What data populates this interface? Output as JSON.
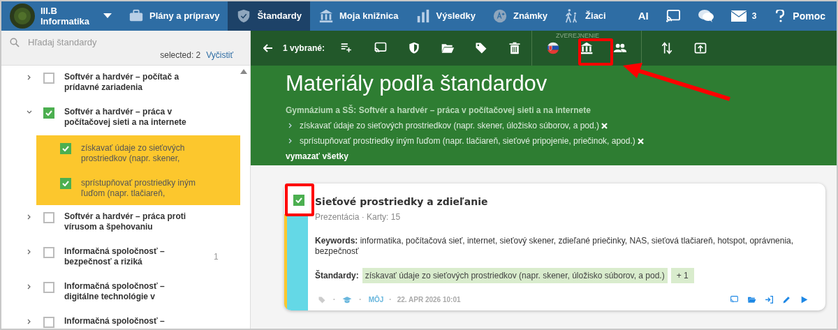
{
  "nav": {
    "brand": [
      "III.B",
      "Informatika"
    ],
    "items": [
      {
        "label": "Plány a prípravy",
        "selected": false
      },
      {
        "label": "Štandardy",
        "selected": true
      },
      {
        "label": "Moja knižnica",
        "selected": false
      },
      {
        "label": "Výsledky",
        "selected": false
      },
      {
        "label": "Známky",
        "selected": false
      },
      {
        "label": "Žiaci",
        "selected": false
      }
    ],
    "right": [
      {
        "kind": "text",
        "label": "AI"
      },
      {
        "kind": "cast"
      },
      {
        "kind": "chat"
      },
      {
        "kind": "mail",
        "badge": "3"
      },
      {
        "kind": "help",
        "label": "Pomoc"
      }
    ]
  },
  "sidebar": {
    "search_placeholder": "Hľadaj štandardy",
    "selected_count": "selected: 2",
    "clear_link": "Vyčistiť",
    "tree": [
      {
        "label": "Softvér a hardvér – počítač a prídavné zariadenia",
        "checked": false,
        "expanded": false
      },
      {
        "label": "Softvér a hardvér – práca v počítačovej sieti a na internete",
        "checked": true,
        "expanded": true,
        "children": [
          {
            "label": "získavať údaje zo sieťových prostriedkov (napr. skener,",
            "checked": true,
            "selected": true
          },
          {
            "label": "sprístupňovať prostriedky iným ľuďom (napr. tlačiareň,",
            "checked": true,
            "selected": true
          }
        ]
      },
      {
        "label": "Softvér a hardvér – práca proti vírusom a špehovaniu",
        "checked": false,
        "expanded": false
      },
      {
        "label": "Informačná spoločnosť – bezpečnosť a riziká",
        "checked": false,
        "expanded": false,
        "count": "1"
      },
      {
        "label": "Informačná spoločnosť – digitálne technológie v",
        "checked": false,
        "expanded": false
      },
      {
        "label": "Informačná spoločnosť –",
        "checked": false,
        "expanded": false
      }
    ]
  },
  "toolbar": {
    "selected_label": "1 vybrané:",
    "group_label": "ZVEREJNENIE"
  },
  "header": {
    "title": "Materiály podľa štandardov",
    "subject": "Gymnázium a SŠ: Softvér a hardvér – práca v počítačovej sieti a na internete",
    "standards": [
      "získavať údaje zo sieťových prostriedkov (napr. skener, úložisko súborov, a pod.)",
      "sprístupňovať prostriedky iným ľuďom (napr. tlačiareň, sieťové pripojenie, priečinok, apod.)"
    ],
    "clear_all": "vymazať všetky"
  },
  "card": {
    "checked": true,
    "title": "Sieťové prostriedky a zdieľanie",
    "meta": "Prezentácia · Karty: 15",
    "keywords": "**Keywords:** informatika, počítačová sieť, internet, sieťový skener, zdieľané priečinky, NAS, sieťová tlačiareň, hotspot, oprávnenia, bezpečnosť",
    "standards_label": "Štandardy:",
    "standard_tag": "získavať údaje zo sieťových prostriedkov (napr. skener, úložisko súborov, a pod.)",
    "more_tag": "+ 1",
    "separators": [
      "·",
      "·",
      "·"
    ],
    "owner": "MÔJ",
    "date": "22. APR 2026 10:01"
  }
}
